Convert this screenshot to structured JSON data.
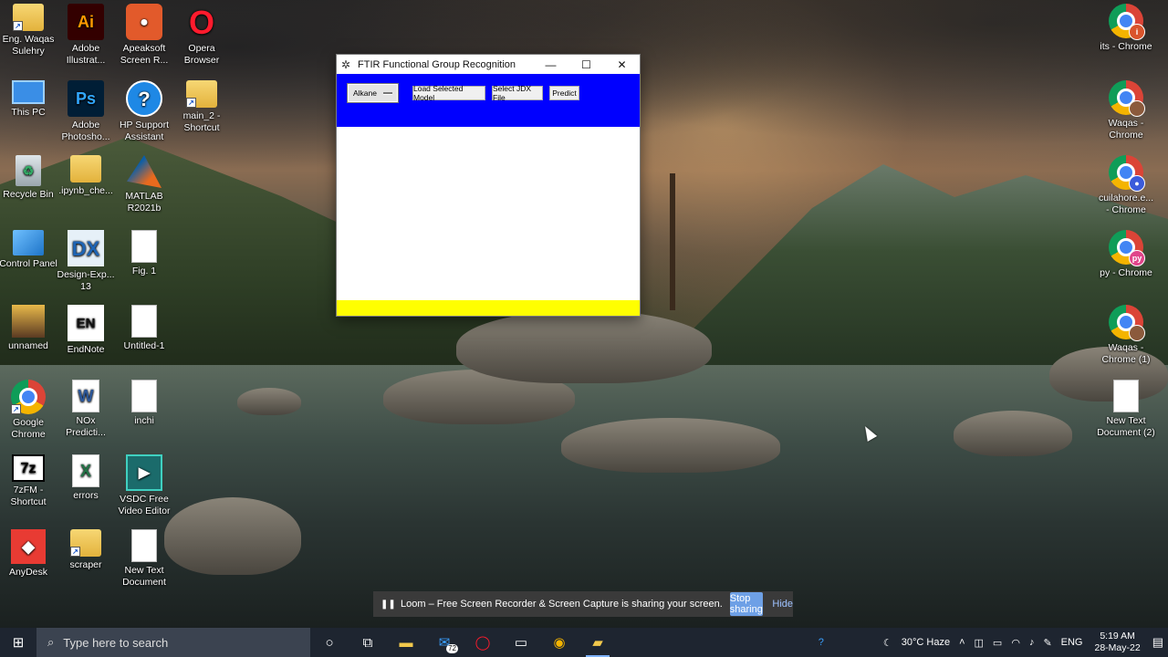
{
  "desktop": {
    "col1": [
      {
        "label": "Eng. Waqas Sulehry",
        "icon": "folder-icon"
      },
      {
        "label": "This PC",
        "icon": "computer-icon"
      },
      {
        "label": "Recycle Bin",
        "icon": "recycle-bin-icon"
      },
      {
        "label": "Control Panel",
        "icon": "control-panel-icon"
      },
      {
        "label": "unnamed",
        "icon": "photo-icon"
      },
      {
        "label": "Google Chrome",
        "icon": "chrome-icon"
      },
      {
        "label": "7zFM - Shortcut",
        "icon": "7zip-icon"
      },
      {
        "label": "AnyDesk",
        "icon": "anydesk-icon"
      }
    ],
    "col2": [
      {
        "label": "Adobe Illustrat...",
        "icon": "illustrator-icon",
        "glyph": "Ai"
      },
      {
        "label": "Adobe Photosho...",
        "icon": "photoshop-icon",
        "glyph": "Ps"
      },
      {
        "label": ".ipynb_che...",
        "icon": "folder-icon"
      },
      {
        "label": "Design-Exp... 13",
        "icon": "design-expert-icon",
        "glyph": "DX"
      },
      {
        "label": "EndNote",
        "icon": "endnote-icon",
        "glyph": "EN"
      },
      {
        "label": "NOx Predicti...",
        "icon": "word-icon",
        "glyph": "W"
      },
      {
        "label": "errors",
        "icon": "excel-icon",
        "glyph": "X"
      },
      {
        "label": "scraper",
        "icon": "folder-icon"
      }
    ],
    "col3": [
      {
        "label": "Apeaksoft Screen R...",
        "icon": "screen-recorder-icon"
      },
      {
        "label": "HP Support Assistant",
        "icon": "help-icon",
        "glyph": "?"
      },
      {
        "label": "MATLAB R2021b",
        "icon": "matlab-icon"
      },
      {
        "label": "Fig. 1",
        "icon": "image-file-icon"
      },
      {
        "label": "Untitled-1",
        "icon": "image-file-icon"
      },
      {
        "label": "inchi",
        "icon": "document-icon"
      },
      {
        "label": "VSDC Free Video Editor",
        "icon": "vsdc-icon"
      },
      {
        "label": "New Text Document",
        "icon": "document-icon"
      }
    ],
    "col4": [
      {
        "label": "Opera Browser",
        "icon": "opera-icon",
        "glyph": "O"
      },
      {
        "label": "main_2 - Shortcut",
        "icon": "folder-icon"
      }
    ],
    "right_col": [
      {
        "label": "its - Chrome",
        "icon": "chrome-icon"
      },
      {
        "label": "Waqas - Chrome",
        "icon": "chrome-icon"
      },
      {
        "label": "cuilahore.e... - Chrome",
        "icon": "chrome-icon"
      },
      {
        "label": "py - Chrome",
        "icon": "chrome-icon",
        "mini": "py"
      },
      {
        "label": "Waqas - Chrome (1)",
        "icon": "chrome-icon"
      },
      {
        "label": "New Text Document (2)",
        "icon": "document-icon"
      }
    ]
  },
  "window": {
    "title": "FTIR Functional Group Recognition",
    "minimize": "—",
    "maximize": "☐",
    "close": "✕",
    "dropdown_value": "Alkane",
    "load_button": "Load Selected Model",
    "select_button": "Select JDX File",
    "predict_button": "Predict",
    "toolbar_color": "#0000ff",
    "status_color": "#ffff00"
  },
  "loom": {
    "message": "Loom – Free Screen Recorder & Screen Capture is sharing your screen.",
    "stop": "Stop sharing",
    "hide": "Hide"
  },
  "taskbar": {
    "search_placeholder": "Type here to search",
    "mail_badge": "72",
    "weather": "30°C  Haze",
    "lang": "ENG",
    "time": "5:19 AM",
    "date": "28-May-22"
  }
}
